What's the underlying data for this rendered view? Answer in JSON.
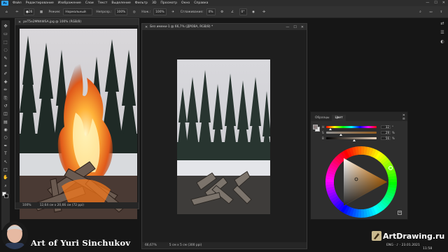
{
  "app": {
    "logo_text": "Ps"
  },
  "menubar": {
    "items": [
      "Файл",
      "Редактирование",
      "Изображение",
      "Слои",
      "Текст",
      "Выделение",
      "Фильтр",
      "3D",
      "Просмотр",
      "Окно",
      "Справка"
    ],
    "window_controls": [
      "—",
      "☐",
      "✕"
    ]
  },
  "options_bar": {
    "brush_size": "26",
    "mode_label": "Режим:",
    "mode_value": "Нормальный",
    "opacity_label": "Непрозр.:",
    "opacity_value": "100%",
    "flow_label": "Наж.:",
    "flow_value": "100%",
    "smoothing_label": "Сглаживание:",
    "smoothing_value": "0%",
    "angle_value": "0°"
  },
  "toolbar": {
    "tools": [
      "move-tool",
      "artboard-tool",
      "marquee-tool",
      "lasso-tool",
      "quick-select-tool",
      "crop-tool",
      "eyedropper-tool",
      "healing-tool",
      "brush-tool",
      "stamp-tool",
      "history-brush-tool",
      "eraser-tool",
      "gradient-tool",
      "blur-tool",
      "dodge-tool",
      "pen-tool",
      "type-tool",
      "path-select-tool",
      "shape-tool",
      "hand-tool",
      "zoom-tool"
    ],
    "tool_glyphs": [
      "✥",
      "▭",
      "⬚",
      "◌",
      "✎",
      "⌗",
      "✐",
      "✚",
      "✏",
      "⎘",
      "↺",
      "◫",
      "▤",
      "◉",
      "○",
      "✒",
      "T",
      "↖",
      "□",
      "✋",
      "⌕"
    ],
    "foreground_color": "#ffffff",
    "background_color": "#000000"
  },
  "right_strip": {
    "icons": [
      "⇄",
      "☰",
      "◐"
    ]
  },
  "doc1": {
    "tab_title": "pxT5e2MNhWSA.jpg @ 100% (RGB/8)",
    "status_zoom": "100%",
    "status_info": "12,64 см x 20,66 см (72 ppi)"
  },
  "doc2": {
    "tab_title": "Без имени-1 @ 66,7% (ДРОВА, RGB/8) *",
    "status_zoom": "66,67%",
    "status_info": "5 см x 5 см (300 ppi)"
  },
  "color_panel": {
    "tabs": [
      "Образцы",
      "Цвет"
    ],
    "active_tab": "Цвет",
    "sliders": [
      {
        "letter": "H",
        "value": "32",
        "unit": "°",
        "thumb_pos": 0.09
      },
      {
        "letter": "S",
        "value": "29",
        "unit": "%",
        "thumb_pos": 0.29
      },
      {
        "letter": "B",
        "value": "56",
        "unit": "%",
        "thumb_pos": 0.56
      }
    ],
    "foreground_color": "#8a7e7e",
    "background_color": "#e8e8e8"
  },
  "watermarks": {
    "left_text": "Art of Yuri Sinchukov",
    "right_text": "ArtDrawing.ru",
    "clock_text": "ENG · ♪ · 23.01.2021",
    "clock_time": "11:58"
  }
}
